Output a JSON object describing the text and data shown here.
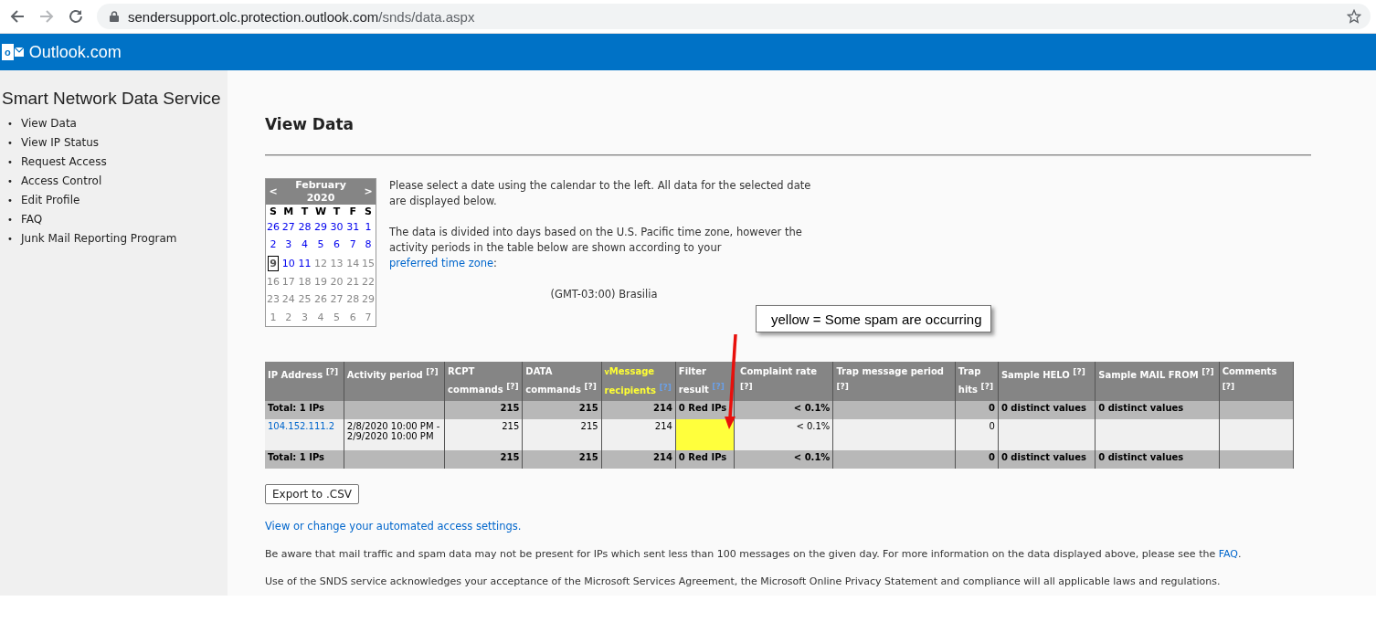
{
  "browser": {
    "url_host": "sendersupport.olc.protection.outlook.com",
    "url_path": "/snds/data.aspx"
  },
  "header": {
    "brand": "Outlook.com",
    "logo_letter": "o"
  },
  "sidebar": {
    "title": "Smart Network Data Service",
    "bullet": "•",
    "items": [
      {
        "label": "View Data"
      },
      {
        "label": "View IP Status"
      },
      {
        "label": "Request Access"
      },
      {
        "label": "Access Control"
      },
      {
        "label": "Edit Profile"
      },
      {
        "label": "FAQ"
      },
      {
        "label": "Junk Mail Reporting Program"
      }
    ]
  },
  "page_title": "View Data",
  "calendar": {
    "prev": "<",
    "next": ">",
    "month": "February",
    "year": "2020",
    "weekdays": [
      "S",
      "M",
      "T",
      "W",
      "T",
      "F",
      "S"
    ],
    "days": [
      {
        "label": "26",
        "linked": true,
        "selected": false
      },
      {
        "label": "27",
        "linked": true,
        "selected": false
      },
      {
        "label": "28",
        "linked": true,
        "selected": false
      },
      {
        "label": "29",
        "linked": true,
        "selected": false
      },
      {
        "label": "30",
        "linked": true,
        "selected": false
      },
      {
        "label": "31",
        "linked": true,
        "selected": false
      },
      {
        "label": "1",
        "linked": true,
        "selected": false
      },
      {
        "label": "2",
        "linked": true,
        "selected": false
      },
      {
        "label": "3",
        "linked": true,
        "selected": false
      },
      {
        "label": "4",
        "linked": true,
        "selected": false
      },
      {
        "label": "5",
        "linked": true,
        "selected": false
      },
      {
        "label": "6",
        "linked": true,
        "selected": false
      },
      {
        "label": "7",
        "linked": true,
        "selected": false
      },
      {
        "label": "8",
        "linked": true,
        "selected": false
      },
      {
        "label": "9",
        "linked": false,
        "selected": true
      },
      {
        "label": "10",
        "linked": true,
        "selected": false
      },
      {
        "label": "11",
        "linked": true,
        "selected": false
      },
      {
        "label": "12",
        "linked": false,
        "selected": false
      },
      {
        "label": "13",
        "linked": false,
        "selected": false
      },
      {
        "label": "14",
        "linked": false,
        "selected": false
      },
      {
        "label": "15",
        "linked": false,
        "selected": false
      },
      {
        "label": "16",
        "linked": false,
        "selected": false
      },
      {
        "label": "17",
        "linked": false,
        "selected": false
      },
      {
        "label": "18",
        "linked": false,
        "selected": false
      },
      {
        "label": "19",
        "linked": false,
        "selected": false
      },
      {
        "label": "20",
        "linked": false,
        "selected": false
      },
      {
        "label": "21",
        "linked": false,
        "selected": false
      },
      {
        "label": "22",
        "linked": false,
        "selected": false
      },
      {
        "label": "23",
        "linked": false,
        "selected": false
      },
      {
        "label": "24",
        "linked": false,
        "selected": false
      },
      {
        "label": "25",
        "linked": false,
        "selected": false
      },
      {
        "label": "26",
        "linked": false,
        "selected": false
      },
      {
        "label": "27",
        "linked": false,
        "selected": false
      },
      {
        "label": "28",
        "linked": false,
        "selected": false
      },
      {
        "label": "29",
        "linked": false,
        "selected": false
      },
      {
        "label": "1",
        "linked": false,
        "selected": false
      },
      {
        "label": "2",
        "linked": false,
        "selected": false
      },
      {
        "label": "3",
        "linked": false,
        "selected": false
      },
      {
        "label": "4",
        "linked": false,
        "selected": false
      },
      {
        "label": "5",
        "linked": false,
        "selected": false
      },
      {
        "label": "6",
        "linked": false,
        "selected": false
      },
      {
        "label": "7",
        "linked": false,
        "selected": false
      }
    ]
  },
  "intro": {
    "text_1": "Please select a date using the calendar to the left. All data for the selected date are displayed below.",
    "text_2": "The data is divided into days based on the U.S. Pacific time zone, however the activity periods in the table below are shown according to your",
    "link": "preferred time zone",
    "text_2_end": ":",
    "timezone": "(GMT-03:00) Brasilia"
  },
  "callout": {
    "text": "yellow = Some spam are occurring"
  },
  "table": {
    "columns": [
      {
        "label": "IP Address",
        "help": "[?]",
        "sorted": false,
        "help_link": false
      },
      {
        "label": "Activity period",
        "help": "[?]",
        "sorted": false,
        "help_link": false
      },
      {
        "label": "RCPT commands",
        "help": "[?]",
        "sorted": false,
        "help_link": false
      },
      {
        "label": "DATA commands",
        "help": "[?]",
        "sorted": false,
        "help_link": false
      },
      {
        "label": "Message recipients",
        "help": "[?]",
        "sorted": true,
        "help_link": true,
        "sort_mark": "v"
      },
      {
        "label": "Filter result",
        "help": "[?]",
        "sorted": false,
        "help_link": true
      },
      {
        "label": "Complaint rate",
        "help": "[?]",
        "sorted": false,
        "help_link": false
      },
      {
        "label": "Trap message period",
        "help": "[?]",
        "sorted": false,
        "help_link": false
      },
      {
        "label": "Trap hits",
        "help": "[?]",
        "sorted": false,
        "help_link": false
      },
      {
        "label": "Sample HELO",
        "help": "[?]",
        "sorted": false,
        "help_link": false
      },
      {
        "label": "Sample MAIL FROM",
        "help": "[?]",
        "sorted": false,
        "help_link": false
      },
      {
        "label": "Comments",
        "help": "[?]",
        "sorted": false,
        "help_link": false
      }
    ],
    "rows": [
      {
        "kind": "total",
        "cells": [
          "Total: 1 IPs",
          null,
          "215",
          "215",
          "214",
          "0 Red IPs",
          "< 0.1%",
          null,
          "0",
          "0 distinct values",
          "0 distinct values",
          null
        ]
      },
      {
        "kind": "ip",
        "color": "#ffff3c",
        "cells": [
          "104.152.111.2",
          "2/8/2020 10:00 PM - 2/9/2020 10:00 PM",
          "215",
          "215",
          "214",
          null,
          "< 0.1%",
          null,
          "0",
          null,
          null,
          null
        ]
      },
      {
        "kind": "total",
        "cells": [
          "Total: 1 IPs",
          null,
          "215",
          "215",
          "214",
          "0 Red IPs",
          "< 0.1%",
          null,
          "0",
          "0 distinct values",
          "0 distinct values",
          null
        ]
      }
    ]
  },
  "export_button": "Export to .CSV",
  "access_link": "View or change your automated access settings.",
  "notice": {
    "text": "Be aware that mail traffic and spam data may not be present for IPs which sent less than 100 messages on the given day.  For more information on the data displayed above, please see the",
    "link": "FAQ",
    "end": "."
  },
  "agreement": "Use of the SNDS service acknowledges your acceptance of the Microsoft Services Agreement, the Microsoft Online Privacy Statement and compliance will all applicable laws and regulations."
}
